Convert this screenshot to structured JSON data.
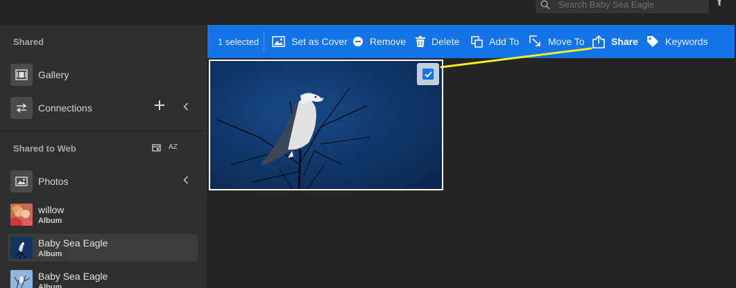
{
  "search": {
    "placeholder": "Search Baby Sea Eagle",
    "icon": "search-icon"
  },
  "sidebar": {
    "shared_title": "Shared",
    "gallery_label": "Gallery",
    "connections_label": "Connections",
    "shared_to_web_title": "Shared to Web",
    "sort_label": "AZ",
    "photos_label": "Photos",
    "albums": [
      {
        "name": "willow",
        "type": "Album",
        "selected": false
      },
      {
        "name": "Baby Sea Eagle",
        "type": "Album",
        "selected": true
      },
      {
        "name": "Baby Sea Eagle",
        "type": "Album",
        "selected": false
      }
    ]
  },
  "actionbar": {
    "selected_count": "1 selected",
    "set_as_cover": "Set as Cover",
    "remove": "Remove",
    "delete": "Delete",
    "add_to": "Add To",
    "move_to": "Move To",
    "share": "Share",
    "keywords": "Keywords"
  },
  "grid": {
    "photo": {
      "subject": "sea-eagle-on-branches",
      "selected": true
    }
  },
  "colors": {
    "accent": "#1473e6",
    "sidebar_bg": "#2f2f2f",
    "content_bg": "#252525",
    "pointer": "#f4f01a"
  }
}
